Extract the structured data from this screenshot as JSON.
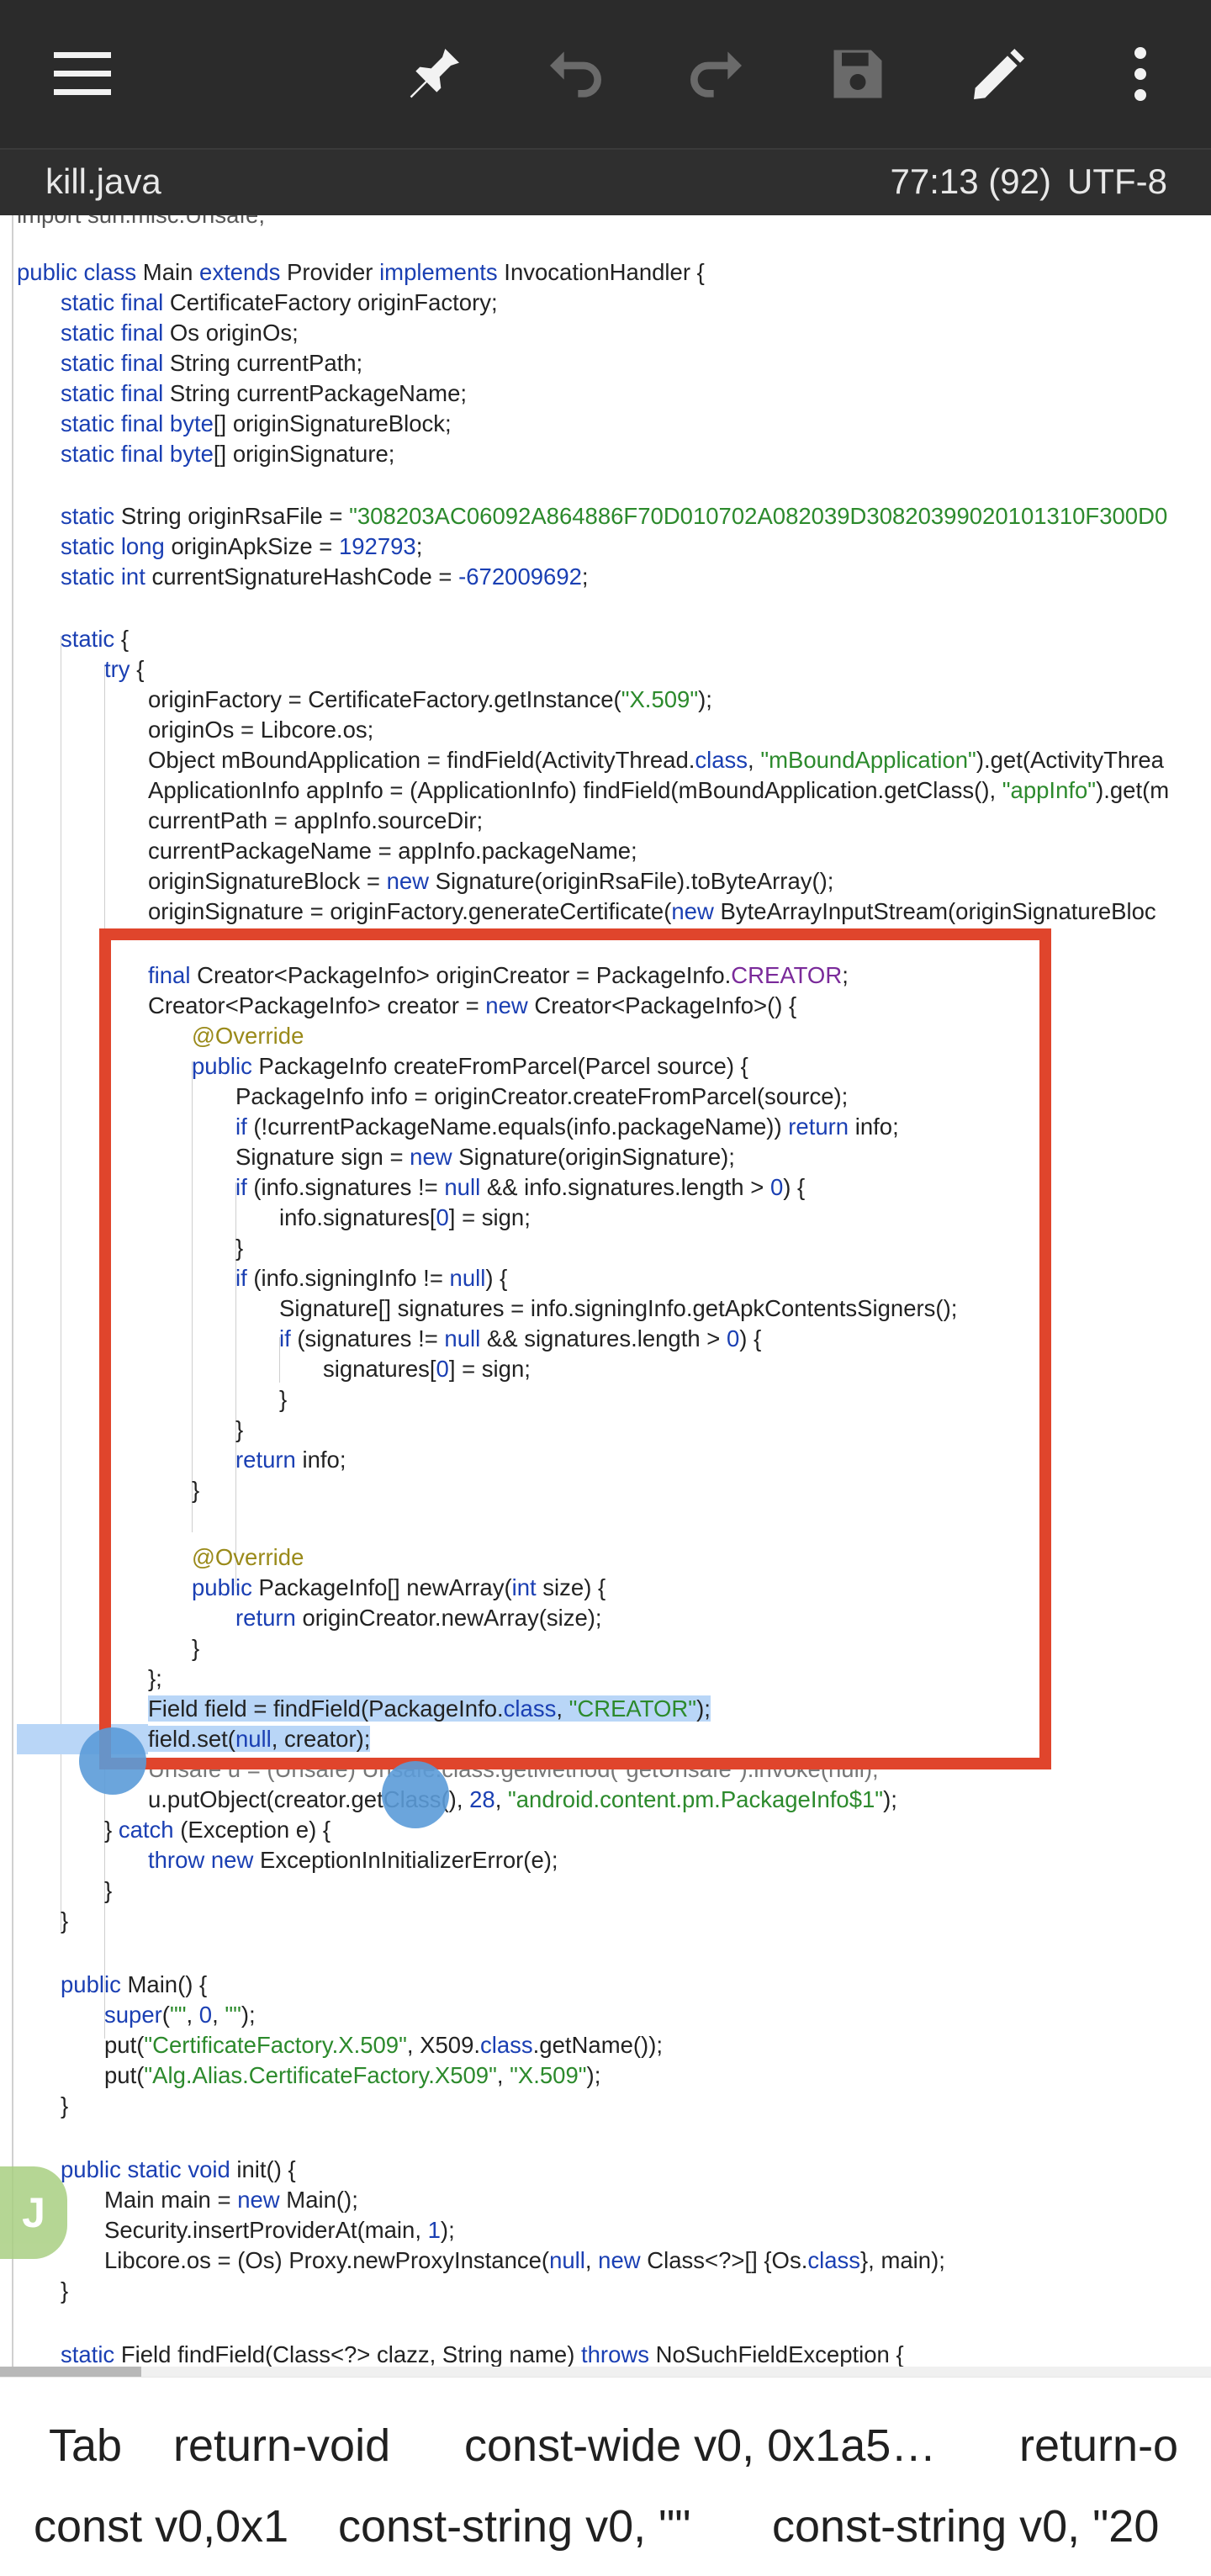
{
  "toolbar": {
    "menu_icon": "hamburger-menu-icon",
    "pin_icon": "pin-icon",
    "undo_icon": "undo-icon",
    "redo_icon": "redo-icon",
    "save_icon": "save-icon",
    "edit_icon": "pencil-icon",
    "more_icon": "more-vertical-icon"
  },
  "status": {
    "filename": "kill.java",
    "cursor": "77:13 (92)",
    "encoding": "UTF-8"
  },
  "colors": {
    "toolbar_bg": "#2b2b2b",
    "keyword": "#1a3fb3",
    "string": "#2c8a2c",
    "annotation": "#9a8a1a",
    "highlight_box": "#e0452c",
    "selection": "#b9d6f7"
  },
  "code": {
    "l01": "import sun.misc.Unsafe;",
    "l02": "public class Main extends Provider implements InvocationHandler {",
    "l03": "static final CertificateFactory originFactory;",
    "l04": "static final Os originOs;",
    "l05": "static final String currentPath;",
    "l06": "static final String currentPackageName;",
    "l07": "static final byte[] originSignatureBlock;",
    "l08": "static final byte[] originSignature;",
    "l09": "static String originRsaFile = \"308203AC06092A864886F70D010702A082039D30820399020101310F300D0",
    "l10": "static long originApkSize = 192793;",
    "l11": "static int currentSignatureHashCode = -672009692;",
    "l12": "static {",
    "l13": "try {",
    "l14": "originFactory = CertificateFactory.getInstance(\"X.509\");",
    "l15": "originOs = Libcore.os;",
    "l16": "Object mBoundApplication = findField(ActivityThread.class, \"mBoundApplication\").get(ActivityThrea",
    "l17": "ApplicationInfo appInfo = (ApplicationInfo) findField(mBoundApplication.getClass(), \"appInfo\").get(m",
    "l18": "currentPath = appInfo.sourceDir;",
    "l19": "currentPackageName = appInfo.packageName;",
    "l20": "originSignatureBlock = new Signature(originRsaFile).toByteArray();",
    "l21": "originSignature = originFactory.generateCertificate(new ByteArrayInputStream(originSignatureBloc",
    "l22": "final Creator<PackageInfo> originCreator = PackageInfo.CREATOR;",
    "l23": "Creator<PackageInfo> creator = new Creator<PackageInfo>() {",
    "l24": "@Override",
    "l25": "public PackageInfo createFromParcel(Parcel source) {",
    "l26": "PackageInfo info = originCreator.createFromParcel(source);",
    "l27": "if (!currentPackageName.equals(info.packageName)) return info;",
    "l28": "Signature sign = new Signature(originSignature);",
    "l29": "if (info.signatures != null && info.signatures.length > 0) {",
    "l30": "info.signatures[0] = sign;",
    "l31": "}",
    "l32": "if (info.signingInfo != null) {",
    "l33": "Signature[] signatures = info.signingInfo.getApkContentsSigners();",
    "l34": "if (signatures != null && signatures.length > 0) {",
    "l35": "signatures[0] = sign;",
    "l36": "}",
    "l37": "}",
    "l38": "return info;",
    "l39": "}",
    "l40": "@Override",
    "l41": "public PackageInfo[] newArray(int size) {",
    "l42": "return originCreator.newArray(size);",
    "l43": "}",
    "l44": "};",
    "l45": "Field field = findField(PackageInfo.class, \"CREATOR\");",
    "l46": "field.set(null, creator);",
    "l47": "Unsafe u = (Unsafe) Unsafe.class.getMethod(\"getUnsafe\").invoke(null);",
    "l48": "u.putObject(creator.getClass(), 28, \"android.content.pm.PackageInfo$1\");",
    "l49": "} catch (Exception e) {",
    "l50": "throw new ExceptionInInitializerError(e);",
    "l51": "}",
    "l52": "}",
    "l53": "public Main() {",
    "l54": "super(\"\", 0, \"\");",
    "l55": "put(\"CertificateFactory.X.509\", X509.class.getName());",
    "l56": "put(\"Alg.Alias.CertificateFactory.X509\", \"X.509\");",
    "l57": "}",
    "l58": "public static void init() {",
    "l59": "Main main = new Main();",
    "l60": "Security.insertProviderAt(main, 1);",
    "l61": "Libcore.os = (Os) Proxy.newProxyInstance(null, new Class<?>[] {Os.class}, main);",
    "l62": "}",
    "l63": "static Field findField(Class<?> clazz, String name) throws NoSuchFieldException {"
  },
  "snippets": {
    "row1": [
      "Tab",
      "return-void",
      "const-wide v0, 0x1a5…",
      "return-o"
    ],
    "row2": [
      "const v0,0x1",
      "const-string v0, \"\"",
      "const-string v0, \"20"
    ]
  }
}
